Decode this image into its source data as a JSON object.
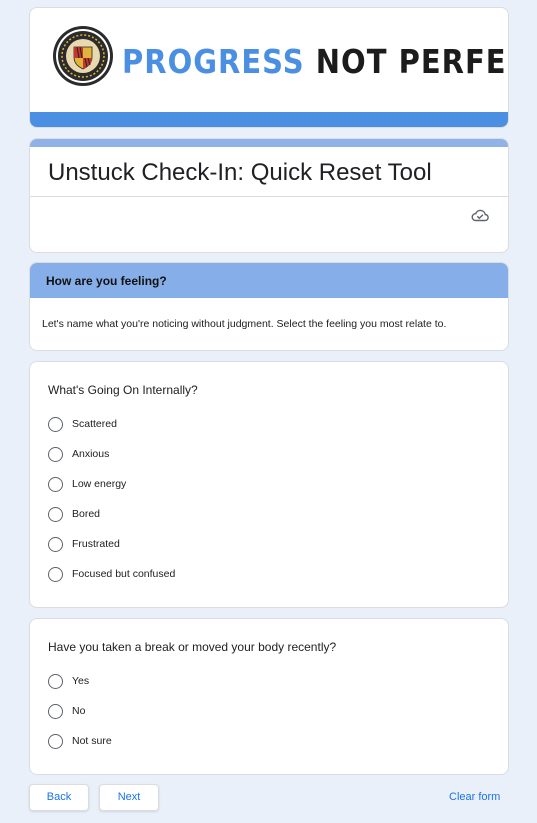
{
  "banner": {
    "title_part1": "PROGRESS",
    "title_part2": "NOT PERFECTION",
    "seal_icon": "county-seal-icon",
    "accent": "#4a8fe2"
  },
  "form": {
    "title": "Unstuck Check-In: Quick Reset Tool",
    "cloud_icon": "cloud-saved-icon"
  },
  "section": {
    "heading": "How are you feeling?",
    "description": "Let's name what you're noticing without judgment. Select the feeling you most relate to.",
    "color": "#86aee8"
  },
  "questions": [
    {
      "title": "What's Going On Internally?",
      "options": [
        "Scattered",
        "Anxious",
        "Low energy",
        "Bored",
        "Frustrated",
        "Focused but confused"
      ]
    },
    {
      "title": "Have you taken a break or moved your body recently?",
      "options": [
        "Yes",
        "No",
        "Not sure"
      ]
    }
  ],
  "footer": {
    "back_label": "Back",
    "next_label": "Next",
    "clear_label": "Clear form"
  }
}
